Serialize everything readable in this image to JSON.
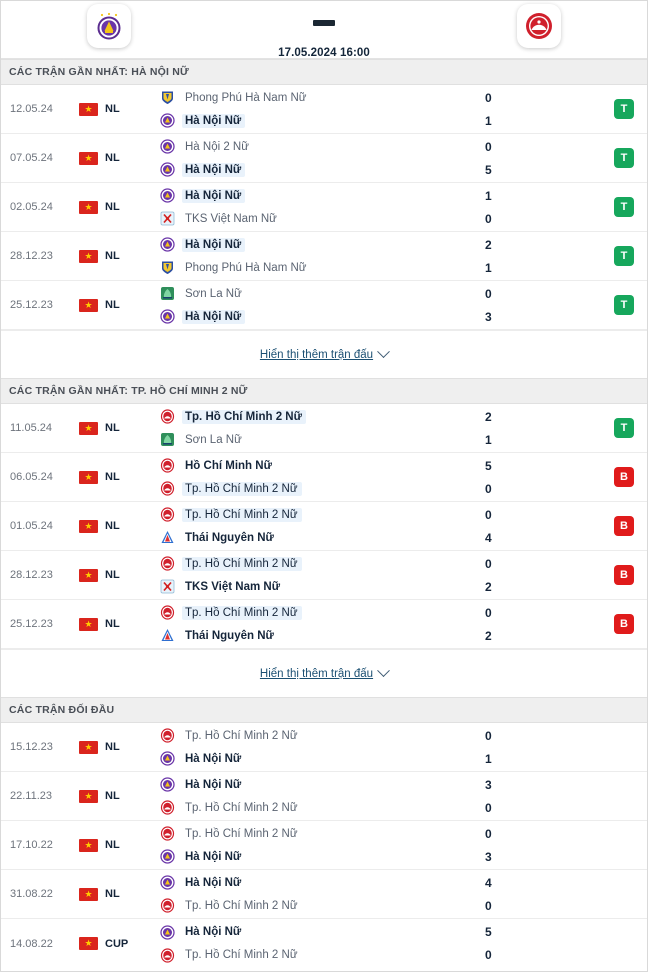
{
  "header": {
    "home_team": "Hà Nội Nữ",
    "away_team": "Tp. Hồ Chí Minh 2 Nữ",
    "score_separator": "-",
    "kickoff": "17.05.2024 16:00"
  },
  "colors": {
    "win_badge": "#16a75c",
    "lose_badge": "#e01b1b",
    "highlight": "#e9f2fb",
    "section_header_bg": "#efefef",
    "link": "#1b4f72"
  },
  "sections": [
    {
      "title": "CÁC TRẬN GẦN NHẤT: HÀ NỘI NỮ",
      "show_more_label": "Hiển thị thêm trận đấu",
      "has_show_more": true,
      "matches": [
        {
          "date": "12.05.24",
          "competition": "NL",
          "flag": "vietnam-flag",
          "home": {
            "name": "Phong Phú Hà Nam Nữ",
            "logo": "phong-phu-ha-nam",
            "winner": false,
            "focus": false
          },
          "away": {
            "name": "Hà Nội Nữ",
            "logo": "ha-noi",
            "winner": true,
            "focus": true
          },
          "home_score": "0",
          "away_score": "1",
          "result": "T",
          "result_type": "win"
        },
        {
          "date": "07.05.24",
          "competition": "NL",
          "flag": "vietnam-flag",
          "home": {
            "name": "Hà Nội 2 Nữ",
            "logo": "ha-noi",
            "winner": false,
            "focus": false
          },
          "away": {
            "name": "Hà Nội Nữ",
            "logo": "ha-noi",
            "winner": true,
            "focus": true
          },
          "home_score": "0",
          "away_score": "5",
          "result": "T",
          "result_type": "win"
        },
        {
          "date": "02.05.24",
          "competition": "NL",
          "flag": "vietnam-flag",
          "home": {
            "name": "Hà Nội Nữ",
            "logo": "ha-noi",
            "winner": true,
            "focus": true
          },
          "away": {
            "name": "TKS Việt Nam Nữ",
            "logo": "tks-viet-nam",
            "winner": false,
            "focus": false
          },
          "home_score": "1",
          "away_score": "0",
          "result": "T",
          "result_type": "win"
        },
        {
          "date": "28.12.23",
          "competition": "NL",
          "flag": "vietnam-flag",
          "home": {
            "name": "Hà Nội Nữ",
            "logo": "ha-noi",
            "winner": true,
            "focus": true
          },
          "away": {
            "name": "Phong Phú Hà Nam Nữ",
            "logo": "phong-phu-ha-nam",
            "winner": false,
            "focus": false
          },
          "home_score": "2",
          "away_score": "1",
          "result": "T",
          "result_type": "win"
        },
        {
          "date": "25.12.23",
          "competition": "NL",
          "flag": "vietnam-flag",
          "home": {
            "name": "Sơn La Nữ",
            "logo": "son-la",
            "winner": false,
            "focus": false
          },
          "away": {
            "name": "Hà Nội Nữ",
            "logo": "ha-noi",
            "winner": true,
            "focus": true
          },
          "home_score": "0",
          "away_score": "3",
          "result": "T",
          "result_type": "win"
        }
      ]
    },
    {
      "title": "CÁC TRẬN GẦN NHẤT: TP. HỒ CHÍ MINH 2 NỮ",
      "show_more_label": "Hiển thị thêm trận đấu",
      "has_show_more": true,
      "matches": [
        {
          "date": "11.05.24",
          "competition": "NL",
          "flag": "vietnam-flag",
          "home": {
            "name": "Tp. Hồ Chí Minh 2 Nữ",
            "logo": "ho-chi-minh",
            "winner": true,
            "focus": true
          },
          "away": {
            "name": "Sơn La Nữ",
            "logo": "son-la",
            "winner": false,
            "focus": false
          },
          "home_score": "2",
          "away_score": "1",
          "result": "T",
          "result_type": "win"
        },
        {
          "date": "06.05.24",
          "competition": "NL",
          "flag": "vietnam-flag",
          "home": {
            "name": "Hồ Chí Minh Nữ",
            "logo": "ho-chi-minh",
            "winner": true,
            "focus": false
          },
          "away": {
            "name": "Tp. Hồ Chí Minh 2 Nữ",
            "logo": "ho-chi-minh",
            "winner": false,
            "focus": true
          },
          "home_score": "5",
          "away_score": "0",
          "result": "B",
          "result_type": "lose"
        },
        {
          "date": "01.05.24",
          "competition": "NL",
          "flag": "vietnam-flag",
          "home": {
            "name": "Tp. Hồ Chí Minh 2 Nữ",
            "logo": "ho-chi-minh",
            "winner": false,
            "focus": true
          },
          "away": {
            "name": "Thái Nguyên Nữ",
            "logo": "thai-nguyen",
            "winner": true,
            "focus": false
          },
          "home_score": "0",
          "away_score": "4",
          "result": "B",
          "result_type": "lose"
        },
        {
          "date": "28.12.23",
          "competition": "NL",
          "flag": "vietnam-flag",
          "home": {
            "name": "Tp. Hồ Chí Minh 2 Nữ",
            "logo": "ho-chi-minh",
            "winner": false,
            "focus": true
          },
          "away": {
            "name": "TKS Việt Nam Nữ",
            "logo": "tks-viet-nam",
            "winner": true,
            "focus": false
          },
          "home_score": "0",
          "away_score": "2",
          "result": "B",
          "result_type": "lose"
        },
        {
          "date": "25.12.23",
          "competition": "NL",
          "flag": "vietnam-flag",
          "home": {
            "name": "Tp. Hồ Chí Minh 2 Nữ",
            "logo": "ho-chi-minh",
            "winner": false,
            "focus": true
          },
          "away": {
            "name": "Thái Nguyên Nữ",
            "logo": "thai-nguyen",
            "winner": true,
            "focus": false
          },
          "home_score": "0",
          "away_score": "2",
          "result": "B",
          "result_type": "lose"
        }
      ]
    },
    {
      "title": "CÁC TRẬN ĐỐI ĐẦU",
      "show_more_label": "",
      "has_show_more": false,
      "matches": [
        {
          "date": "15.12.23",
          "competition": "NL",
          "flag": "vietnam-flag",
          "home": {
            "name": "Tp. Hồ Chí Minh 2 Nữ",
            "logo": "ho-chi-minh",
            "winner": false,
            "focus": false
          },
          "away": {
            "name": "Hà Nội Nữ",
            "logo": "ha-noi",
            "winner": true,
            "focus": false
          },
          "home_score": "0",
          "away_score": "1",
          "result": "",
          "result_type": "none"
        },
        {
          "date": "22.11.23",
          "competition": "NL",
          "flag": "vietnam-flag",
          "home": {
            "name": "Hà Nội Nữ",
            "logo": "ha-noi",
            "winner": true,
            "focus": false
          },
          "away": {
            "name": "Tp. Hồ Chí Minh 2 Nữ",
            "logo": "ho-chi-minh",
            "winner": false,
            "focus": false
          },
          "home_score": "3",
          "away_score": "0",
          "result": "",
          "result_type": "none"
        },
        {
          "date": "17.10.22",
          "competition": "NL",
          "flag": "vietnam-flag",
          "home": {
            "name": "Tp. Hồ Chí Minh 2 Nữ",
            "logo": "ho-chi-minh",
            "winner": false,
            "focus": false
          },
          "away": {
            "name": "Hà Nội Nữ",
            "logo": "ha-noi",
            "winner": true,
            "focus": false
          },
          "home_score": "0",
          "away_score": "3",
          "result": "",
          "result_type": "none"
        },
        {
          "date": "31.08.22",
          "competition": "NL",
          "flag": "vietnam-flag",
          "home": {
            "name": "Hà Nội Nữ",
            "logo": "ha-noi",
            "winner": true,
            "focus": false
          },
          "away": {
            "name": "Tp. Hồ Chí Minh 2 Nữ",
            "logo": "ho-chi-minh",
            "winner": false,
            "focus": false
          },
          "home_score": "4",
          "away_score": "0",
          "result": "",
          "result_type": "none"
        },
        {
          "date": "14.08.22",
          "competition": "CUP",
          "flag": "vietnam-flag",
          "home": {
            "name": "Hà Nội Nữ",
            "logo": "ha-noi",
            "winner": true,
            "focus": false
          },
          "away": {
            "name": "Tp. Hồ Chí Minh 2 Nữ",
            "logo": "ho-chi-minh",
            "winner": false,
            "focus": false
          },
          "home_score": "5",
          "away_score": "0",
          "result": "",
          "result_type": "none"
        }
      ]
    }
  ]
}
